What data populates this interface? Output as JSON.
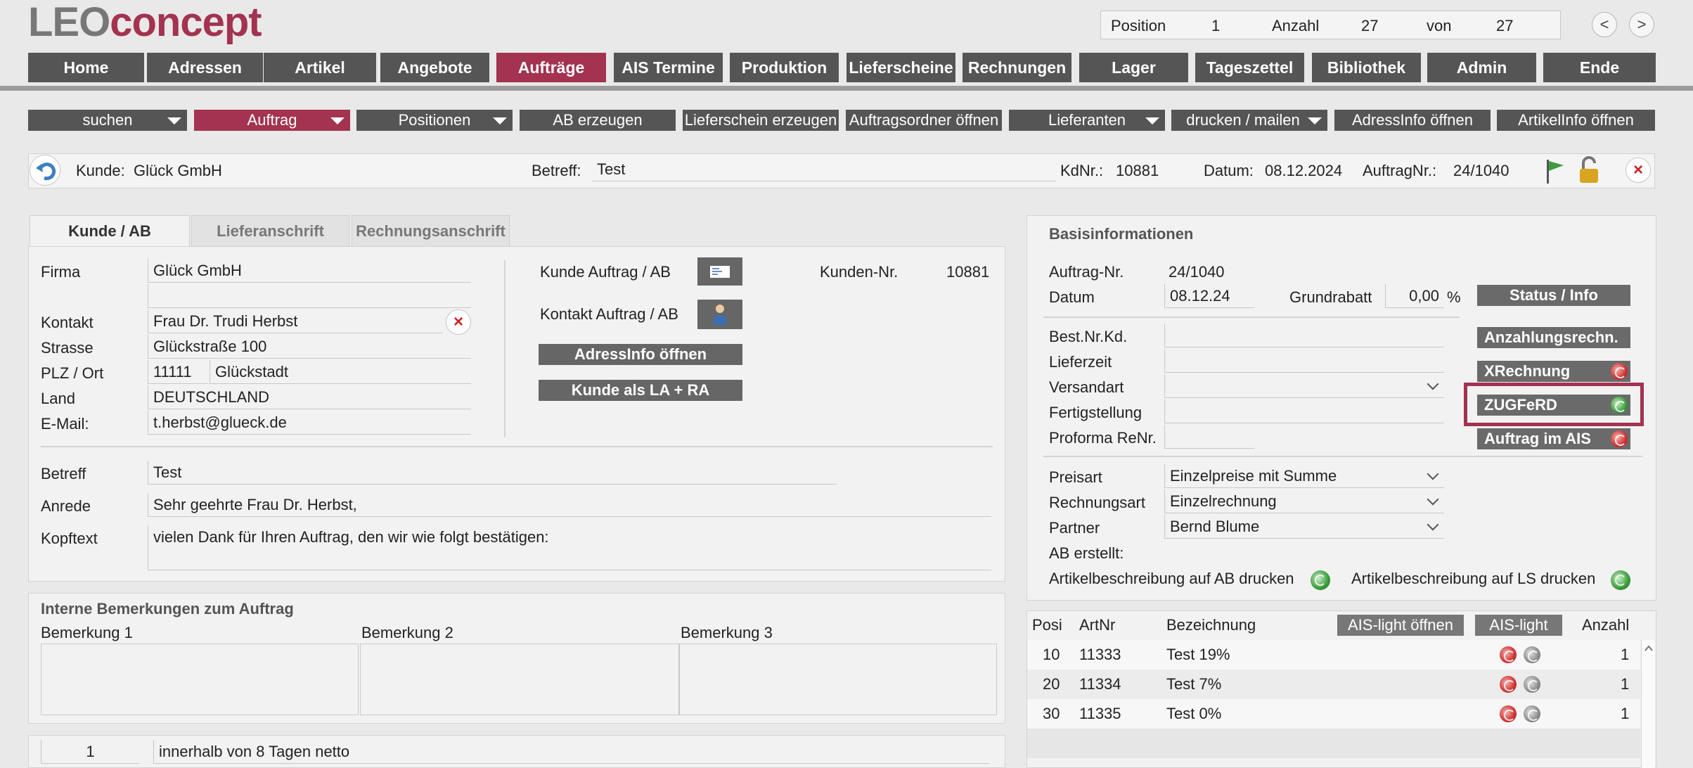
{
  "logo": {
    "part1": "LEO",
    "part2": "concept"
  },
  "position": {
    "pos_label": "Position",
    "pos_value": "1",
    "count_label": "Anzahl",
    "count_value": "27",
    "of_label": "von",
    "of_value": "27"
  },
  "nav": {
    "prev": "<",
    "next": ">"
  },
  "menu": [
    "Home",
    "Adressen",
    "Artikel",
    "Angebote",
    "Aufträge",
    "AIS Termine",
    "Produktion",
    "Lieferscheine",
    "Rechnungen",
    "Lager",
    "Tageszettel",
    "Bibliothek",
    "Admin",
    "Ende"
  ],
  "toolbar": [
    "suchen",
    "Auftrag",
    "Positionen",
    "AB erzeugen",
    "Lieferschein erzeugen",
    "Auftragsordner öffnen",
    "Lieferanten",
    "drucken / mailen",
    "AdressInfo öffnen",
    "ArtikelInfo öffnen"
  ],
  "header": {
    "kunde_label": "Kunde:",
    "kunde_value": "Glück GmbH",
    "betreff_label": "Betreff:",
    "betreff_value": "Test",
    "kdnr_label": "KdNr.:",
    "kdnr_value": "10881",
    "datum_label": "Datum:",
    "datum_value": "08.12.2024",
    "auftragnr_label": "AuftragNr.:",
    "auftragnr_value": "24/1040"
  },
  "tabs": [
    "Kunde / AB",
    "Lieferanschrift",
    "Rechnungsanschrift"
  ],
  "customer": {
    "firma_label": "Firma",
    "firma": "Glück GmbH",
    "firma2": "",
    "kontakt_label": "Kontakt",
    "kontakt": "Frau Dr. Trudi Herbst",
    "strasse_label": "Strasse",
    "strasse": "Glückstraße 100",
    "plz_label": "PLZ / Ort",
    "plz": "11111",
    "ort": "Glückstadt",
    "land_label": "Land",
    "land": "DEUTSCHLAND",
    "email_label": "E-Mail:",
    "email": "t.herbst@glueck.de",
    "kunde_auftrag_label": "Kunde Auftrag / AB",
    "kontakt_auftrag_label": "Kontakt Auftrag / AB",
    "adressinfo_btn": "AdressInfo öffnen",
    "kunde_la_ra_btn": "Kunde als LA + RA",
    "kundennr_label": "Kunden-Nr.",
    "kundennr": "10881",
    "betreff_label": "Betreff",
    "betreff": "Test",
    "anrede_label": "Anrede",
    "anrede": "Sehr geehrte Frau Dr. Herbst,",
    "kopftext_label": "Kopftext",
    "kopftext": "vielen Dank für Ihren Auftrag, den wir wie folgt bestätigen:"
  },
  "remarks": {
    "title": "Interne Bemerkungen zum Auftrag",
    "labels": [
      "Bemerkung 1",
      "Bemerkung 2",
      "Bemerkung 3"
    ]
  },
  "payment": {
    "num": "1",
    "text": "innerhalb von 8 Tagen netto"
  },
  "basis": {
    "title": "Basisinformationen",
    "auftragnr_label": "Auftrag-Nr.",
    "auftragnr": "24/1040",
    "datum_label": "Datum",
    "datum": "08.12.24",
    "grundrabatt_label": "Grundrabatt",
    "grundrabatt": "0,00",
    "percent": "%",
    "best_label": "Best.Nr.Kd.",
    "lieferzeit_label": "Lieferzeit",
    "versandart_label": "Versandart",
    "fertig_label": "Fertigstellung",
    "proforma_label": "Proforma ReNr.",
    "preisart_label": "Preisart",
    "preisart": "Einzelpreise mit Summe",
    "rechnungsart_label": "Rechnungsart",
    "rechnungsart": "Einzelrechnung",
    "partner_label": "Partner",
    "partner": "Bernd Blume",
    "ab_erstellt_label": "AB erstellt:",
    "artikel_ab_label": "Artikelbeschreibung auf AB drucken",
    "artikel_ls_label": "Artikelbeschreibung auf LS drucken",
    "buttons": [
      "Status / Info",
      "Anzahlungsrechn.",
      "XRechnung",
      "ZUGFeRD",
      "Auftrag im AIS"
    ]
  },
  "positions": {
    "headers": {
      "posi": "Posi",
      "artnr": "ArtNr",
      "bez": "Bezeichnung",
      "ais_open": "AIS-light öffnen",
      "ais": "AIS-light",
      "anzahl": "Anzahl"
    },
    "rows": [
      {
        "posi": "10",
        "artnr": "11333",
        "bez": "Test 19%",
        "anzahl": "1"
      },
      {
        "posi": "20",
        "artnr": "11334",
        "bez": "Test 7%",
        "anzahl": "1"
      },
      {
        "posi": "30",
        "artnr": "11335",
        "bez": "Test 0%",
        "anzahl": "1"
      }
    ]
  },
  "colors": {
    "accent": "#a3334f",
    "button": "#555555",
    "panel": "#f2f2f2"
  }
}
